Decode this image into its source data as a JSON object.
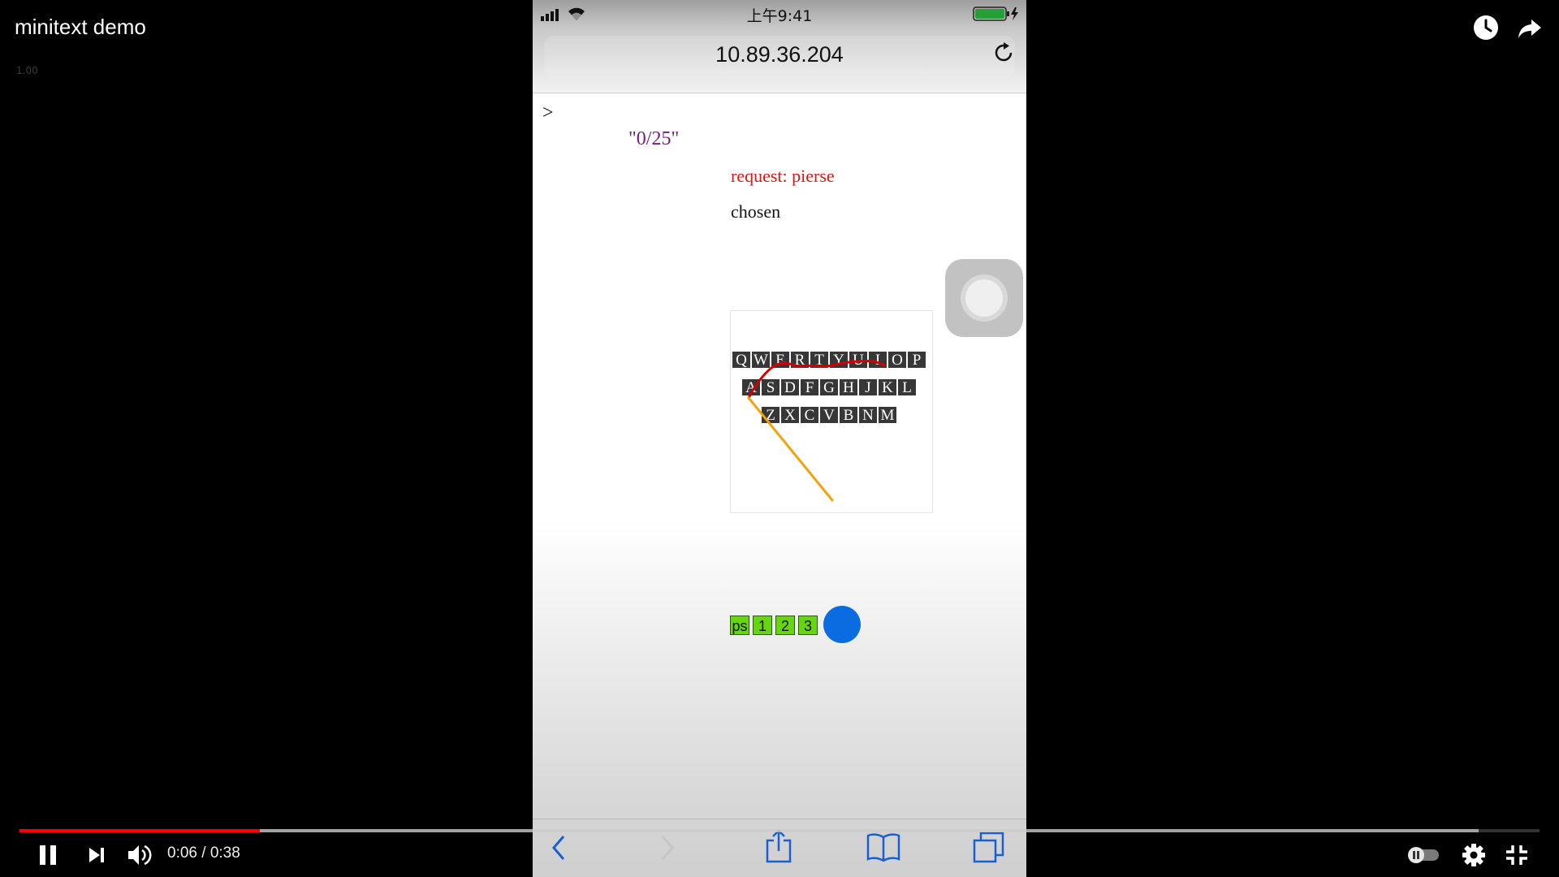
{
  "video": {
    "title": "minitext demo",
    "speed": "1.00",
    "time": "0:06 / 0:38",
    "played_fraction": 0.158,
    "buffered_fraction": 0.96,
    "icons": {
      "watch_later": "clock-icon",
      "share": "share-arrow-icon",
      "pause": "pause-icon",
      "next": "next-icon",
      "volume": "volume-icon",
      "autoplay": "autoplay-toggle-icon",
      "settings": "gear-icon",
      "exit_fullscreen": "exit-fullscreen-icon"
    },
    "colors": {
      "progress": "#ff0000"
    }
  },
  "phone": {
    "status": {
      "time": "上午9:41"
    },
    "url": "10.89.36.204",
    "page": {
      "prompt": ">",
      "counter": "\"0/25\"",
      "request": "request: pierse",
      "chosen": "chosen",
      "keyboard": {
        "rows": [
          [
            "Q",
            "W",
            "E",
            "R",
            "T",
            "Y",
            "U",
            "I",
            "O",
            "P"
          ],
          [
            "A",
            "S",
            "D",
            "F",
            "G",
            "H",
            "J",
            "K",
            "L"
          ],
          [
            "Z",
            "X",
            "C",
            "V",
            "B",
            "N",
            "M"
          ]
        ]
      },
      "candidates": [
        "ps",
        "1",
        "2",
        "3"
      ]
    },
    "colors": {
      "counter": "#701e74",
      "request": "#e2150d",
      "candidate": "#66d613",
      "trace_red": "#d40000",
      "trace_orange": "#f5a20a",
      "touch": "#0a6ce0"
    }
  }
}
